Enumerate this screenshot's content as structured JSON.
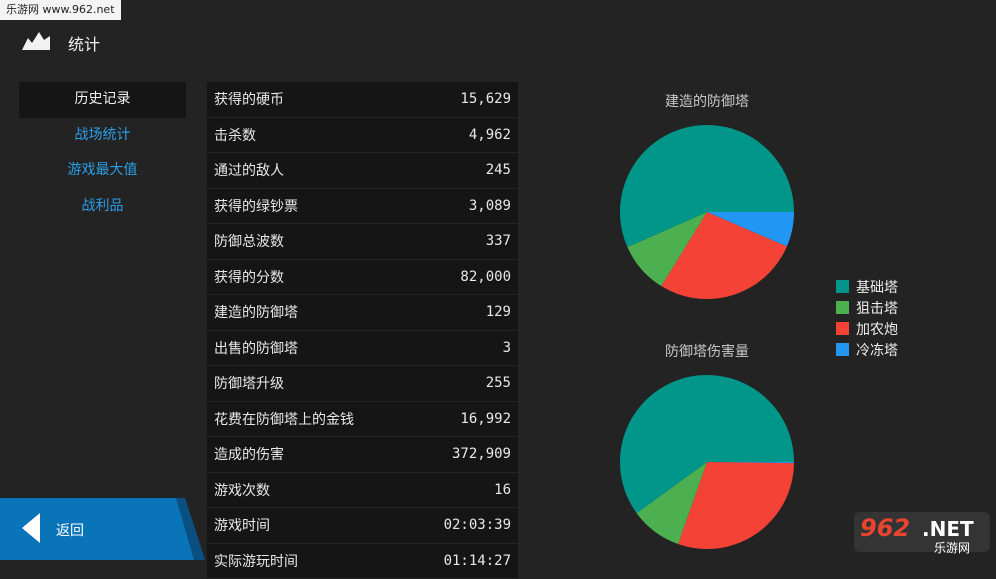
{
  "watermark": {
    "top": "乐游网 www.962.net",
    "logo_big": "962",
    "logo_net": ".NET",
    "logo_sub": "乐游网"
  },
  "header": {
    "title": "统计"
  },
  "sidebar": {
    "items": [
      {
        "label": "历史记录",
        "active": true
      },
      {
        "label": "战场统计",
        "active": false
      },
      {
        "label": "游戏最大值",
        "active": false
      },
      {
        "label": "战利品",
        "active": false
      }
    ]
  },
  "stats": [
    {
      "label": "获得的硬币",
      "value": "15,629"
    },
    {
      "label": "击杀数",
      "value": "4,962"
    },
    {
      "label": "通过的敌人",
      "value": "245"
    },
    {
      "label": "获得的绿钞票",
      "value": "3,089"
    },
    {
      "label": "防御总波数",
      "value": "337"
    },
    {
      "label": "获得的分数",
      "value": "82,000"
    },
    {
      "label": "建造的防御塔",
      "value": "129"
    },
    {
      "label": "出售的防御塔",
      "value": "3"
    },
    {
      "label": "防御塔升级",
      "value": "255"
    },
    {
      "label": "花费在防御塔上的金钱",
      "value": "16,992"
    },
    {
      "label": "造成的伤害",
      "value": "372,909"
    },
    {
      "label": "游戏次数",
      "value": "16"
    },
    {
      "label": "游戏时间",
      "value": "02:03:39"
    },
    {
      "label": "实际游玩时间",
      "value": "01:14:27"
    }
  ],
  "legend": [
    {
      "label": "基础塔",
      "color": "#00968a"
    },
    {
      "label": "狙击塔",
      "color": "#4caf50"
    },
    {
      "label": "加农炮",
      "color": "#f44336"
    },
    {
      "label": "冷冻塔",
      "color": "#2196f3"
    }
  ],
  "chart_data": [
    {
      "type": "pie",
      "title": "建造的防御塔",
      "labels": [
        "基础塔",
        "狙击塔",
        "加农炮",
        "冷冻塔"
      ],
      "values": [
        0.566,
        0.096,
        0.273,
        0.065
      ],
      "colors": [
        "#00968a",
        "#4caf50",
        "#f44336",
        "#2196f3"
      ]
    },
    {
      "type": "pie",
      "title": "防御塔伤害量",
      "labels": [
        "基础塔",
        "狙击塔",
        "加农炮",
        "冷冻塔"
      ],
      "values": [
        0.6,
        0.096,
        0.302,
        0.002
      ],
      "colors": [
        "#00968a",
        "#4caf50",
        "#f44336",
        "#2196f3"
      ]
    }
  ],
  "footer": {
    "back_label": "返回"
  }
}
